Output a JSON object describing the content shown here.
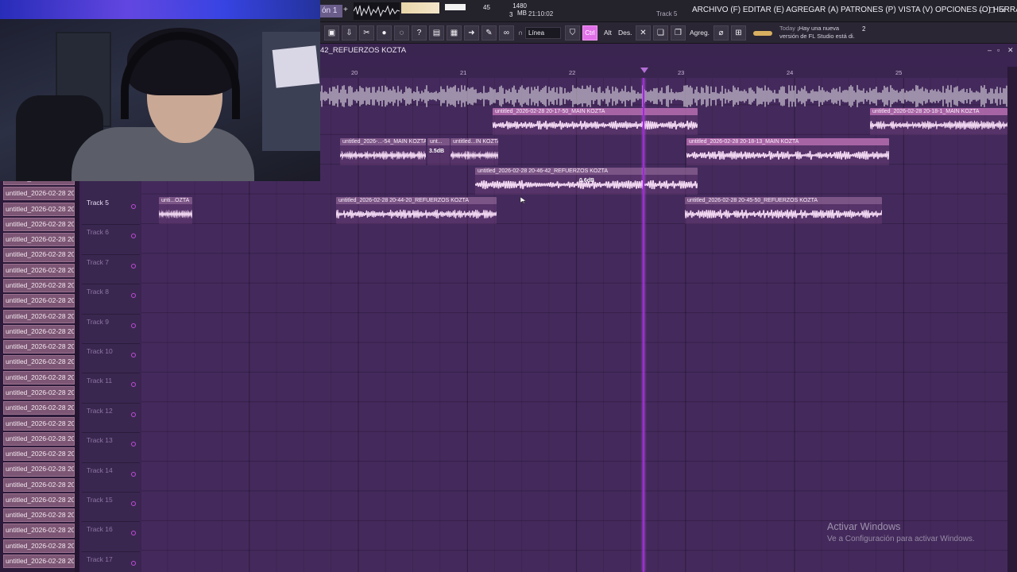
{
  "app": {
    "pattern_selector": "ón 1",
    "cpu_value": "45",
    "memory": "1480 MB",
    "polyphony": "3",
    "clock": "21:10:02",
    "hint": "Track 5",
    "menu": "ARCHIVO (F) EDITAR (E) AGREGAR (A) PATRONES (P) VISTA (V) OPCIONES (O) HERRAMIENTAS (T) AYUDA"
  },
  "toolbar": {
    "snap_mode": "Línea",
    "ctrl_label": "Ctrl",
    "alt_label": "Alt",
    "des_label": "Des.",
    "agreg_label": "Agreg.",
    "news_today": "Today",
    "news_text": "¡Hay una nueva versión de FL Studio está di.",
    "news_badge": "2"
  },
  "playlist": {
    "title": "42_REFUERZOS KOZTA",
    "ruler_bars": [
      "20",
      "21",
      "22",
      "23",
      "24",
      "25"
    ]
  },
  "tracks": [
    {
      "name": "Track 5",
      "active": true
    },
    {
      "name": "Track 6",
      "active": false
    },
    {
      "name": "Track 7",
      "active": false
    },
    {
      "name": "Track 8",
      "active": false
    },
    {
      "name": "Track 9",
      "active": false
    },
    {
      "name": "Track 10",
      "active": false
    },
    {
      "name": "Track 11",
      "active": false
    },
    {
      "name": "Track 12",
      "active": false
    },
    {
      "name": "Track 13",
      "active": false
    },
    {
      "name": "Track 14",
      "active": false
    },
    {
      "name": "Track 15",
      "active": false
    },
    {
      "name": "Track 16",
      "active": false
    },
    {
      "name": "Track 17",
      "active": false
    }
  ],
  "clip_list": {
    "label": "untitled_2026-02-28 20-",
    "count": 26
  },
  "clips": {
    "c1": "untitled_2026-02-28 20-17-50_MAIN KOZTA",
    "c2": "untitled_2026-02-28 20-18-1_MAIN KOZTA",
    "c3": "untitled_2026-...-54_MAIN KOZTA",
    "c4": "unt...",
    "c5": "untitled...IN KOZTA",
    "c6": "untitled_2026-02-28 20-18-13_MAIN KOZTA",
    "c7": "untitled_2026-02-28 20-46-42_REFUERZOS KOZTA",
    "c8": "unti...OZTA",
    "c9": "untitled_2026-02-28 20-44-20_REFUERZOS KOZTA",
    "c10": "untitled_2026-02-28 20-45-50_REFUERZOS KOZTA",
    "gain_a": "3.5dB",
    "gain_b": "0.6dB"
  },
  "watermark": {
    "line1": "Activar Windows",
    "line2": "Ve a Configuración para activar Windows."
  },
  "colors": {
    "accent": "#e070e8",
    "playhead": "#a02ad6",
    "background": "#442a5c"
  }
}
